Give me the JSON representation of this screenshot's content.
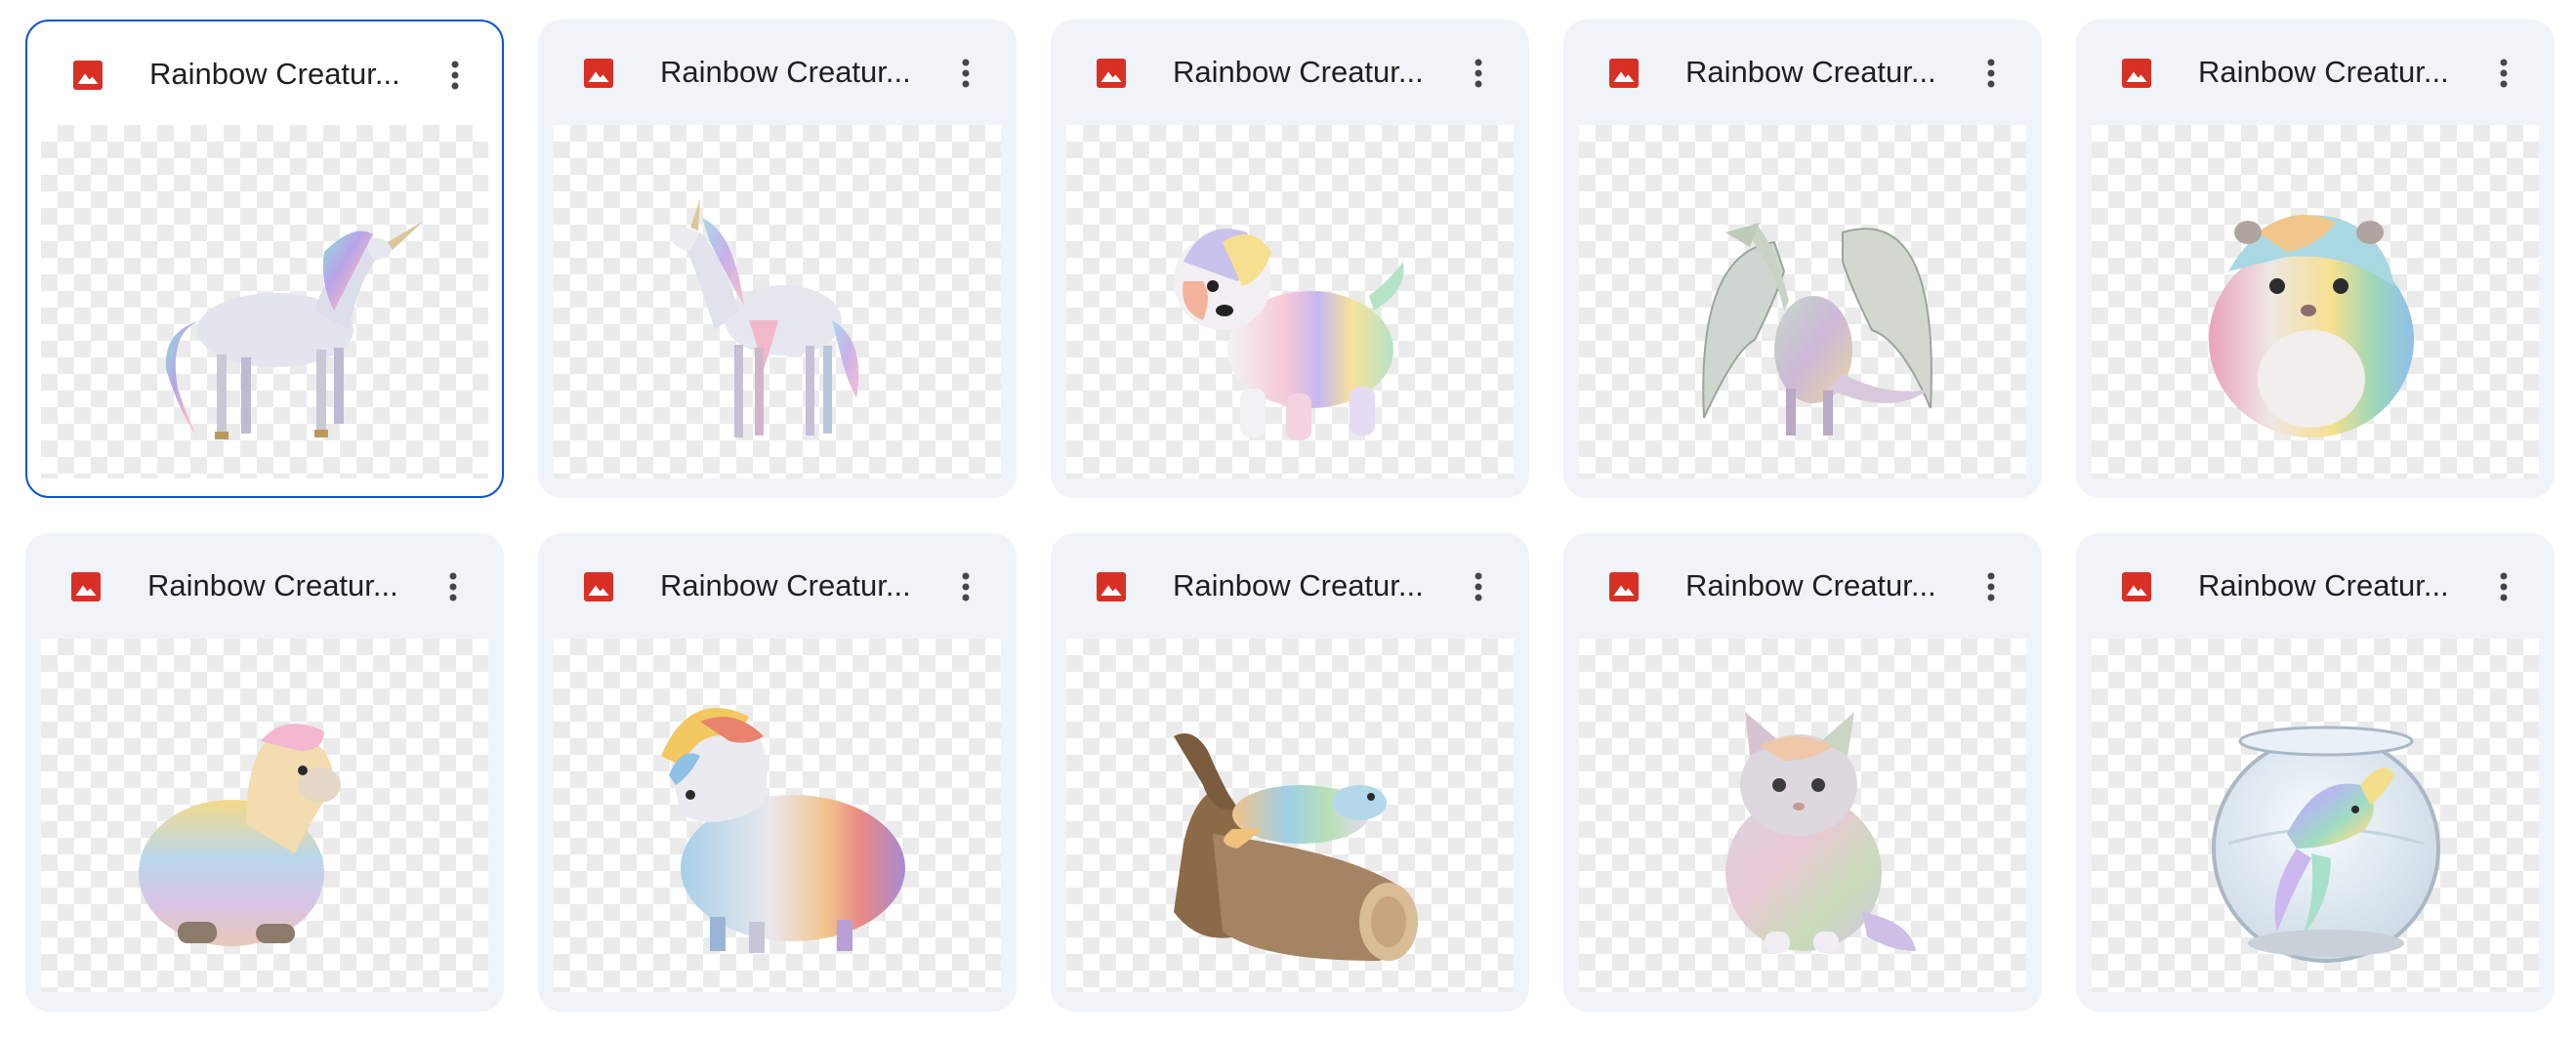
{
  "files": [
    {
      "title": "Rainbow Creatur...",
      "type": "image",
      "subject": "unicorn",
      "selected": true
    },
    {
      "title": "Rainbow Creatur...",
      "type": "image",
      "subject": "unicorn",
      "selected": false
    },
    {
      "title": "Rainbow Creatur...",
      "type": "image",
      "subject": "dog",
      "selected": false
    },
    {
      "title": "Rainbow Creatur...",
      "type": "image",
      "subject": "dragon",
      "selected": false
    },
    {
      "title": "Rainbow Creatur...",
      "type": "image",
      "subject": "hamster",
      "selected": false
    },
    {
      "title": "Rainbow Creatur...",
      "type": "image",
      "subject": "llama",
      "selected": false
    },
    {
      "title": "Rainbow Creatur...",
      "type": "image",
      "subject": "yak",
      "selected": false
    },
    {
      "title": "Rainbow Creatur...",
      "type": "image",
      "subject": "lizard-on-log",
      "selected": false
    },
    {
      "title": "Rainbow Creatur...",
      "type": "image",
      "subject": "cat",
      "selected": false
    },
    {
      "title": "Rainbow Creatur...",
      "type": "image",
      "subject": "fish-in-bowl",
      "selected": false
    }
  ],
  "icons": {
    "file_type": "image-file-icon",
    "more": "more-vert-icon"
  },
  "colors": {
    "card_bg": "#f0f4f9",
    "selected_border": "#0b57d0",
    "image_icon_red": "#d93025",
    "text": "#1f1f1f"
  }
}
